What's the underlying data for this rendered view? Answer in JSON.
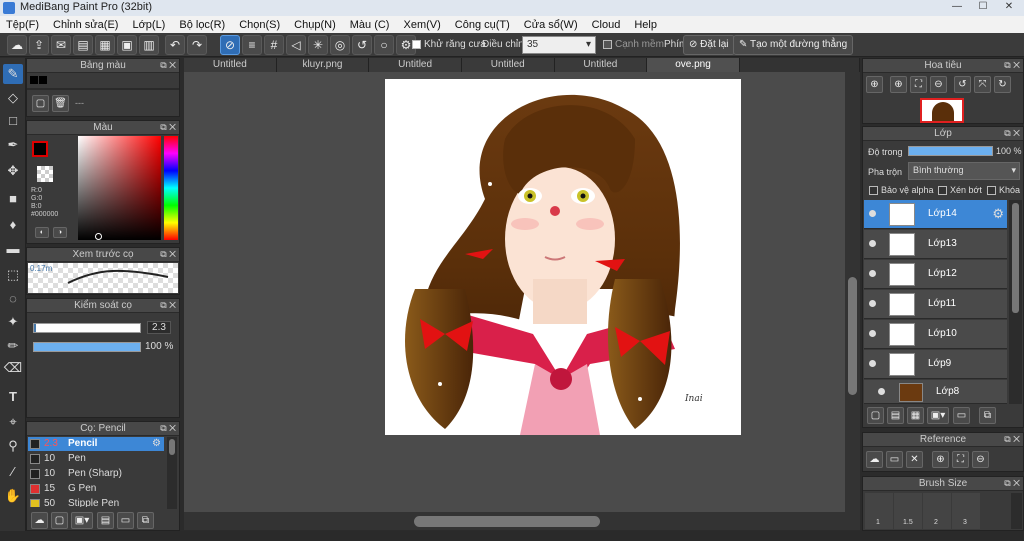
{
  "app": {
    "title": "MediBang Paint Pro (32bit)"
  },
  "menu": [
    "Tệp(F)",
    "Chỉnh sửa(E)",
    "Lớp(L)",
    "Bộ lọc(R)",
    "Chọn(S)",
    "Chụp(N)",
    "Màu (C)",
    "Xem(V)",
    "Công cụ(T)",
    "Cửa sổ(W)",
    "Cloud",
    "Help"
  ],
  "toolbar": {
    "antialias": "Khử răng cưa",
    "correction_label": "Điều chỉnh",
    "correction_value": "35",
    "edge": "Cạnh mềm",
    "key_label": "Phím",
    "reset": "Đặt lại",
    "straight": "Tạo một đường thẳng"
  },
  "tabs": [
    "Untitled",
    "kluyr.png",
    "Untitled",
    "Untitled",
    "Untitled",
    "ove.png"
  ],
  "panels": {
    "palette": "Bảng màu",
    "palette_placeholder": "---",
    "color": "Màu",
    "rgb": {
      "r": "R:0",
      "g": "G:0",
      "b": "B:0",
      "hex": "#000000"
    },
    "brush_preview": "Xem trước cọ",
    "brush_preview_size": "0.17m",
    "brush_control": "Kiểm soát cọ",
    "brush_size": "2.3",
    "brush_opacity": "100 %",
    "brush_list": "Cọ: Pencil",
    "navigator": "Hoa tiêu",
    "layer": "Lớp",
    "opacity_label": "Độ trong",
    "opacity_value": "100 %",
    "blend_label": "Pha trộn",
    "blend_value": "Bình thường",
    "protect_alpha": "Bảo vệ alpha",
    "clip": "Xén bớt",
    "lock": "Khóa",
    "reference": "Reference",
    "brush_size_panel": "Brush Size",
    "sizes": [
      "1",
      "1.5",
      "2",
      "3"
    ]
  },
  "brushes": [
    {
      "size": "2.3",
      "name": "Pencil",
      "color": "#222222"
    },
    {
      "size": "10",
      "name": "Pen",
      "color": "#222222"
    },
    {
      "size": "10",
      "name": "Pen (Sharp)",
      "color": "#222222"
    },
    {
      "size": "15",
      "name": "G Pen",
      "color": "#e03030"
    },
    {
      "size": "50",
      "name": "Stipple Pen",
      "color": "#e0c020"
    }
  ],
  "layers": [
    "Lớp14",
    "Lớp13",
    "Lớp12",
    "Lớp11",
    "Lớp10",
    "Lớp9",
    "Lớp8"
  ],
  "signature": "Inai"
}
